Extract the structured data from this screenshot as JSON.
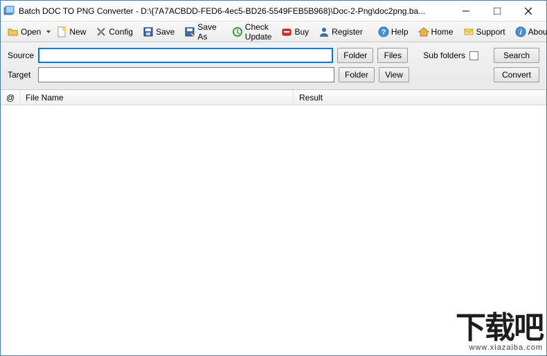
{
  "titlebar": {
    "title": "Batch DOC TO PNG Converter - D:\\{7A7ACBDD-FED6-4ec5-BD26-5549FEB5B968}\\Doc-2-Png\\doc2png.ba..."
  },
  "toolbar": {
    "open": "Open",
    "new": "New",
    "config": "Config",
    "save": "Save",
    "saveas": "Save As",
    "checkupdate": "Check Update",
    "buy": "Buy",
    "register": "Register",
    "help": "Help",
    "home": "Home",
    "support": "Support",
    "about": "About"
  },
  "form": {
    "source_label": "Source",
    "source_value": "",
    "target_label": "Target",
    "target_value": "",
    "folder_btn": "Folder",
    "files_btn": "Files",
    "view_btn": "View",
    "subfolders": "Sub folders",
    "search": "Search",
    "convert": "Convert"
  },
  "columns": {
    "at": "@",
    "filename": "File Name",
    "result": "Result"
  },
  "watermark": {
    "text": "下载吧",
    "url": "www.xiazaiba.com"
  }
}
